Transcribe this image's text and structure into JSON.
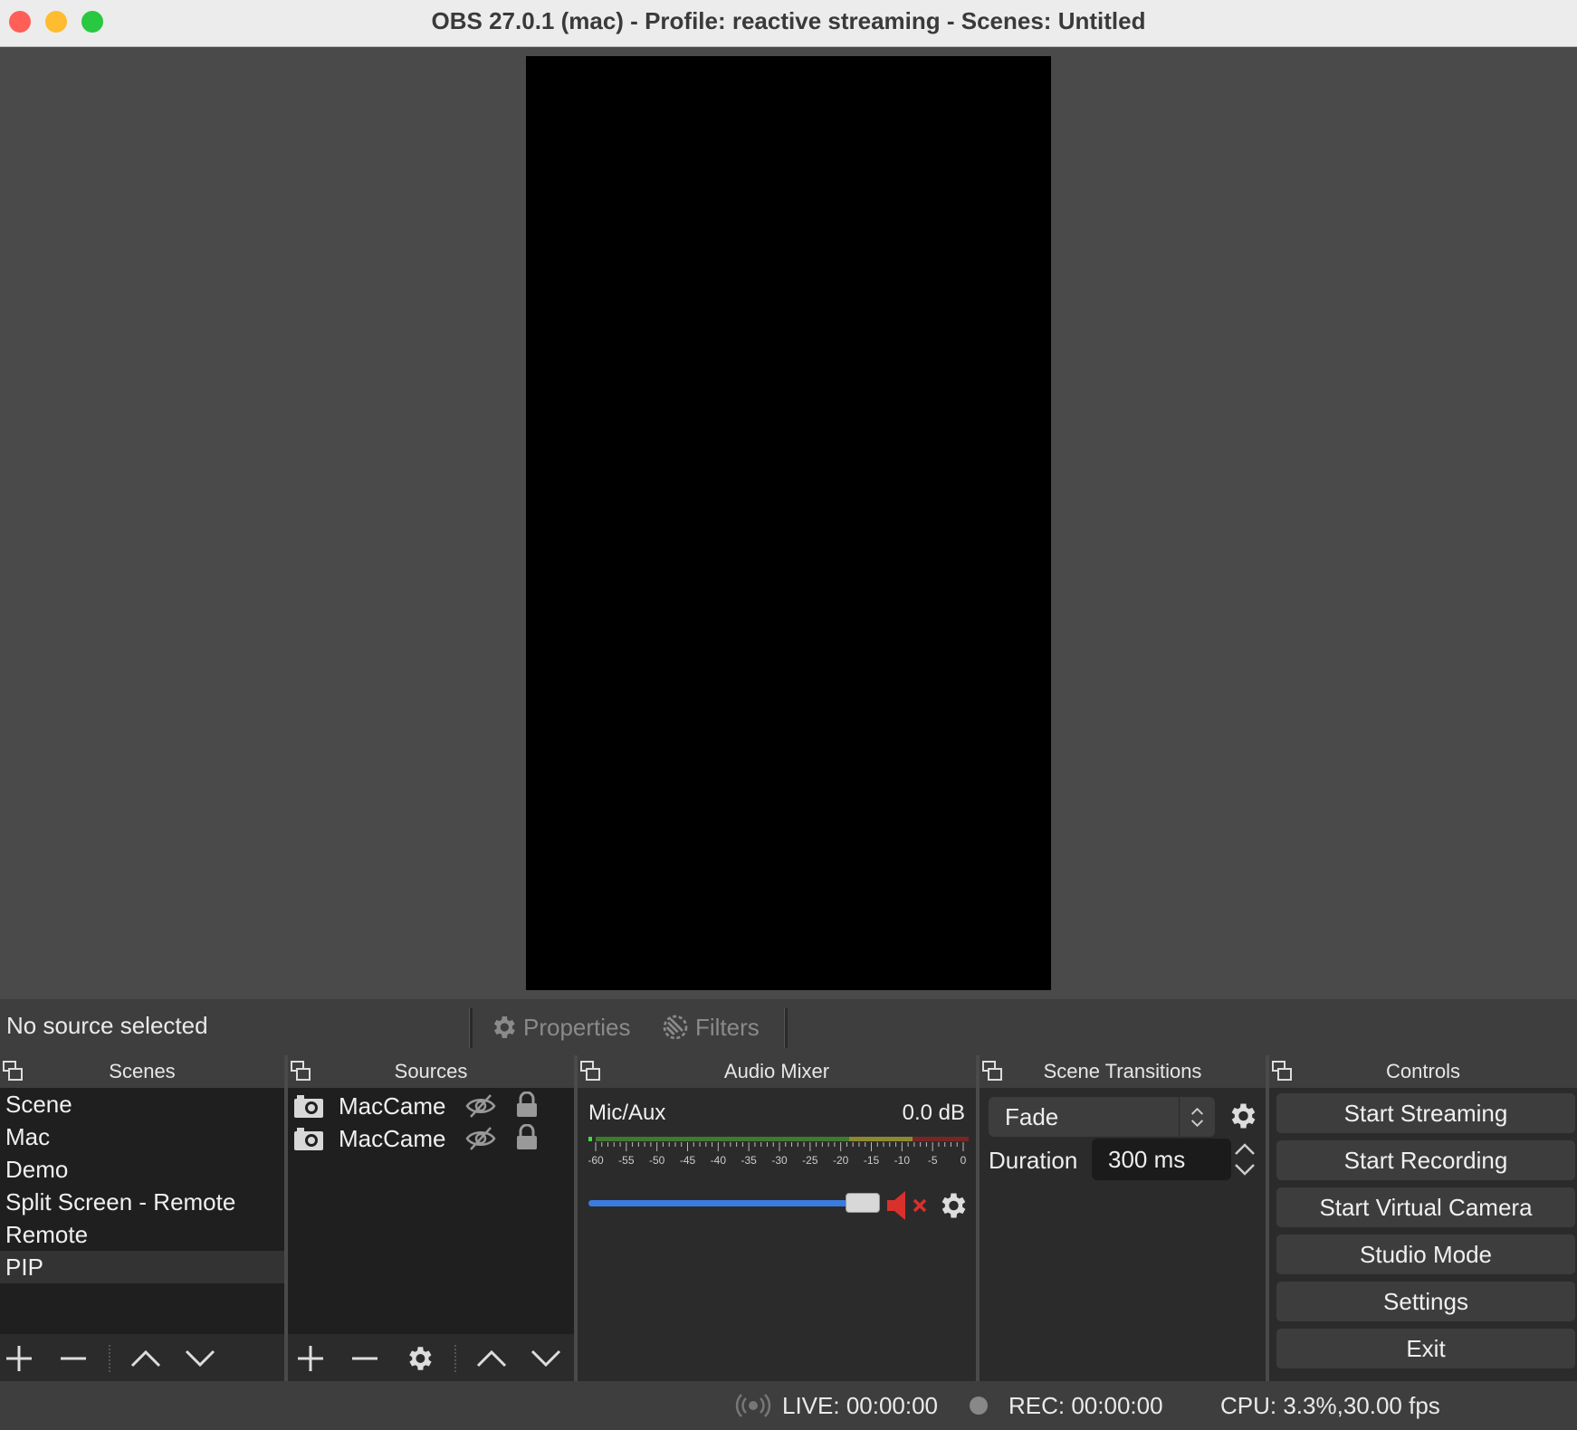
{
  "window": {
    "title": "OBS 27.0.1 (mac) - Profile: reactive streaming - Scenes: Untitled",
    "traffic_lights": [
      "#ff5f57",
      "#febc2e",
      "#28c840"
    ]
  },
  "context_bar": {
    "no_source": "No source selected",
    "properties_label": "Properties",
    "filters_label": "Filters"
  },
  "scenes": {
    "title": "Scenes",
    "items": [
      "Scene",
      "Mac",
      "Demo",
      "Split Screen - Remote",
      "Remote",
      "PIP"
    ],
    "selected": "PIP"
  },
  "sources": {
    "title": "Sources",
    "items": [
      {
        "name": "MacCame",
        "icon": "camera-icon",
        "visible": false,
        "locked": true
      },
      {
        "name": "MacCame",
        "icon": "camera-icon",
        "visible": false,
        "locked": true
      }
    ]
  },
  "mixer": {
    "title": "Audio Mixer",
    "channel": {
      "name": "Mic/Aux",
      "level": "0.0 dB",
      "scale": [
        "-60",
        "-55",
        "-50",
        "-45",
        "-40",
        "-35",
        "-30",
        "-25",
        "-20",
        "-15",
        "-10",
        "-5",
        "0"
      ],
      "volume_fraction": 1.0,
      "muted": true
    }
  },
  "transitions": {
    "title": "Scene Transitions",
    "selected": "Fade",
    "duration_label": "Duration",
    "duration_value": "300 ms"
  },
  "controls": {
    "title": "Controls",
    "buttons": [
      "Start Streaming",
      "Start Recording",
      "Start Virtual Camera",
      "Studio Mode",
      "Settings",
      "Exit"
    ]
  },
  "status": {
    "live": "LIVE: 00:00:00",
    "rec": "REC: 00:00:00",
    "cpu": "CPU: 3.3%,30.00 fps"
  },
  "colors": {
    "accent": "#3b7be0",
    "mute_red": "#d9302c"
  }
}
